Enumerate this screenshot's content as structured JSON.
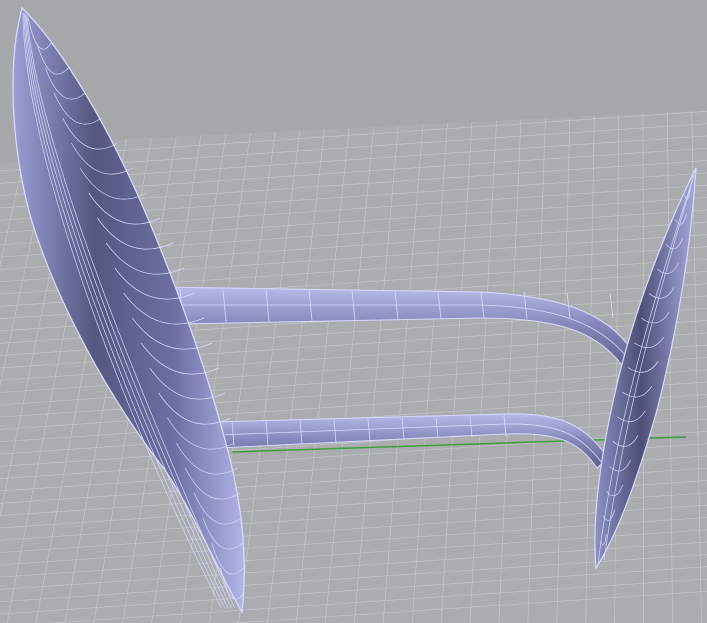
{
  "viewport": {
    "view": "perspective",
    "display_mode": "shaded-wireframe",
    "background_color": "#a4a8ab",
    "grid_line_color": "#c7c9cc",
    "grid_major_color": "#b7bbbf",
    "x_axis_color": "#3fa03f",
    "surface_fill": "#6b6d9e",
    "surface_highlight": "#b6b8e8",
    "isocurve_color": "#d8d9ff"
  },
  "objects": [
    {
      "name": "main-hull",
      "kind": "hull"
    },
    {
      "name": "outrigger-float",
      "kind": "float"
    },
    {
      "name": "forward-crossbeam",
      "kind": "beam"
    },
    {
      "name": "aft-crossbeam",
      "kind": "beam"
    }
  ]
}
